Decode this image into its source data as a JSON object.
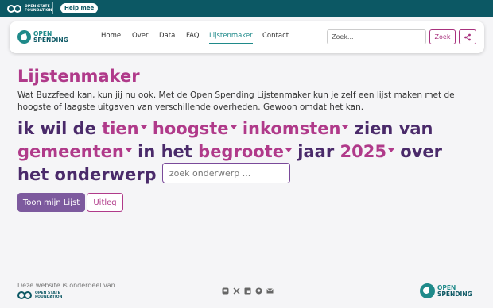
{
  "topbar": {
    "osf_line1": "OPEN STATE",
    "osf_line2": "FOUNDATION",
    "help_label": "Help mee"
  },
  "header": {
    "logo_line1": "OPEN",
    "logo_line2": "SPENDING",
    "nav": [
      "Home",
      "Over",
      "Data",
      "FAQ",
      "Lijstenmaker",
      "Contact"
    ],
    "active_nav": "Lijstenmaker",
    "search_placeholder": "Zoek...",
    "search_button": "Zoek",
    "share_icon": "share-icon"
  },
  "main": {
    "title": "Lijstenmaker",
    "intro": "Wat Buzzfeed kan, kun jij nu ook. Met de Open Spending Lijstenmaker kun je zelf een lijst maken met de hoogste of laagste uitgaven van verschillende overheden. Gewoon omdat het kan.",
    "sentence": {
      "w1": "ik wil de",
      "count": "tien",
      "order": "hoogste",
      "kind": "inkomsten",
      "w2": "zien van",
      "government": "gemeenten",
      "w3": "in het",
      "plan": "begroote",
      "w4": "jaar",
      "year": "2025",
      "w5": "over",
      "w6": "het onderwerp",
      "topic_placeholder": "zoek onderwerp ..."
    },
    "primary_button": "Toon mijn Lijst",
    "secondary_button": "Uitleg"
  },
  "footer": {
    "text": "Deze website is onderdeel van",
    "osf_line1": "OPEN STATE",
    "osf_line2": "FOUNDATION",
    "social_icons": [
      "mastodon-icon",
      "x-icon",
      "linkedin-icon",
      "github-icon",
      "mail-icon"
    ],
    "logo_line1": "OPEN",
    "logo_line2": "SPENDING"
  },
  "colors": {
    "topbar": "#0c5864",
    "accent": "#b03a8a",
    "heading_dark": "#4a2a6a",
    "teal": "#1f8a8a",
    "button_purple": "#7d5a9e"
  }
}
